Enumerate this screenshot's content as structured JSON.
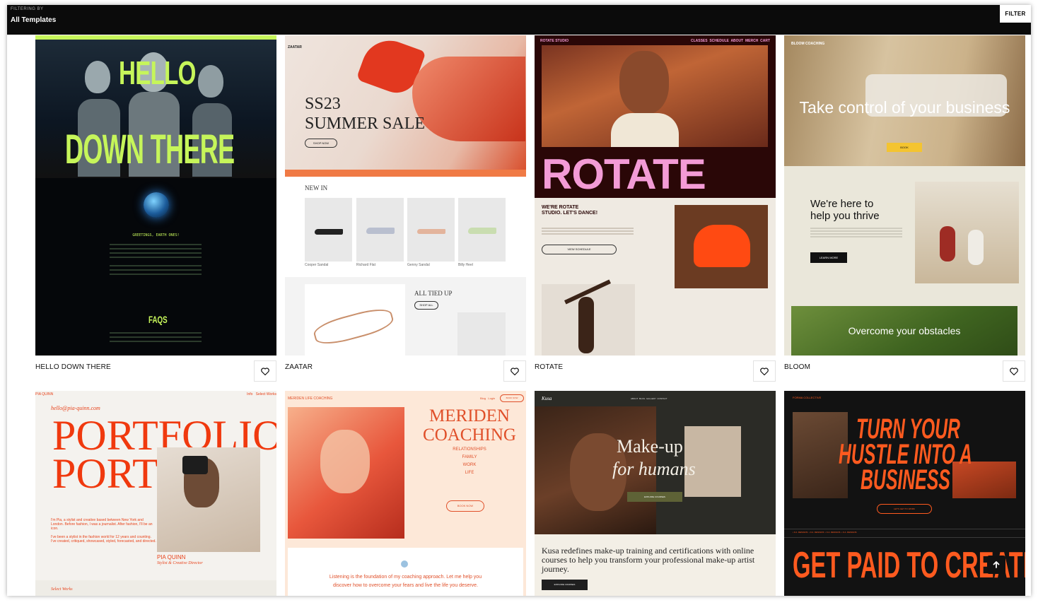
{
  "filterbar": {
    "caption": "FILTERING BY",
    "value": "All Templates",
    "filter_button": "FILTER"
  },
  "templates": [
    {
      "name": "HELLO DOWN THERE",
      "headline_1": "HELLO",
      "headline_2": "DOWN THERE",
      "section": "FAQS",
      "intro": "GREETINGS, EARTH ONES!"
    },
    {
      "name": "ZAATAR",
      "logo": "ZAATAR",
      "banner": "SS23",
      "banner_2": "SUMMER SALE",
      "shop_button": "SHOP NOW",
      "section_new": "NEW IN",
      "products": [
        "Cooper Sandal",
        "Richard Flat",
        "Genny Sandal",
        "Billy Heel"
      ],
      "section_2": "ALL TIED UP",
      "shop_all": "SHOP ALL"
    },
    {
      "name": "ROTATE",
      "studio": "ROTATE STUDIO",
      "nav": "CLASSES  SCHEDULE  ABOUT  MERCH  CART",
      "headline": "ROTATE",
      "tagline": "WE'RE ROTATE STUDIO. LET'S DANCE!",
      "cta": "VIEW SCHEDULE"
    },
    {
      "name": "BLOOM",
      "brand": "BLOOM COACHING",
      "hero": "Take control of your business",
      "hero_cta": "BOOK",
      "sub": "We're here to help you thrive",
      "sub_cta": "LEARN MORE",
      "banner": "Overcome your obstacles"
    },
    {
      "name": "PIA QUINN",
      "brand": "PIA QUINN",
      "nav": "Info   Select Works",
      "email": "hello@pia-quinn.com",
      "headline_1": "PORTFOLIO",
      "headline_2": "PORTF",
      "bio": "I'm Pia, a stylist and creative based between New York and London. Before fashion, I was a journalist. After fashion, I'll be an icon.",
      "bio_2": "I've been a stylist in the fashion world for 12 years and counting. I've created, critiqued, showcased, styled, forecasted, and directed.",
      "person": "PIA QUINN",
      "role": "Stylist & Creative Director",
      "footer": "Select Works"
    },
    {
      "name": "MERIDEN",
      "brand": "MERIDEN LIFE COACHING",
      "login": "Blog   Login",
      "book": "BOOK NOW",
      "headline_1": "MERIDEN",
      "headline_2": "COACHING",
      "topics": [
        "RELATIONSHIPS",
        "FAMILY",
        "WORK",
        "LIFE"
      ],
      "cta": "BOOK NOW",
      "quote": "Listening is the foundation of my coaching approach. Let me help you discover how to overcome your fears and live the life you deserve."
    },
    {
      "name": "KUSA",
      "brand": "Kusa",
      "nav": "ABOUT  BLOG  GALLERY  CONTACT",
      "headline_1": "Make-up",
      "headline_2": "for humans",
      "cta": "EXPLORE COURSES",
      "body": "Kusa redefines make-up training and certifications with online courses to help you transform your professional make-up artist journey.",
      "cta_2": "EXPLORE COURSES"
    },
    {
      "name": "FORMA",
      "brand": "FORMA COLLECTIVE",
      "headline_1": "TURN YOUR",
      "headline_2": "HUSTLE INTO A",
      "headline_3": "BUSINESS",
      "cta": "LET'S GET TO WORK",
      "ticker": "• F.A. DESIGNS  • F.A. DESIGNS  • F.A. DESIGNS  • F.A. DESIGNS",
      "footer": "GET PAID TO CREATE"
    }
  ],
  "colors": {
    "accent_green": "#c6f55a",
    "rotate_pink": "#f39bd6",
    "orange": "#ff4a12",
    "bloom_yellow": "#f4c430"
  },
  "icons": [
    "heart-icon",
    "arrow-up-icon"
  ]
}
